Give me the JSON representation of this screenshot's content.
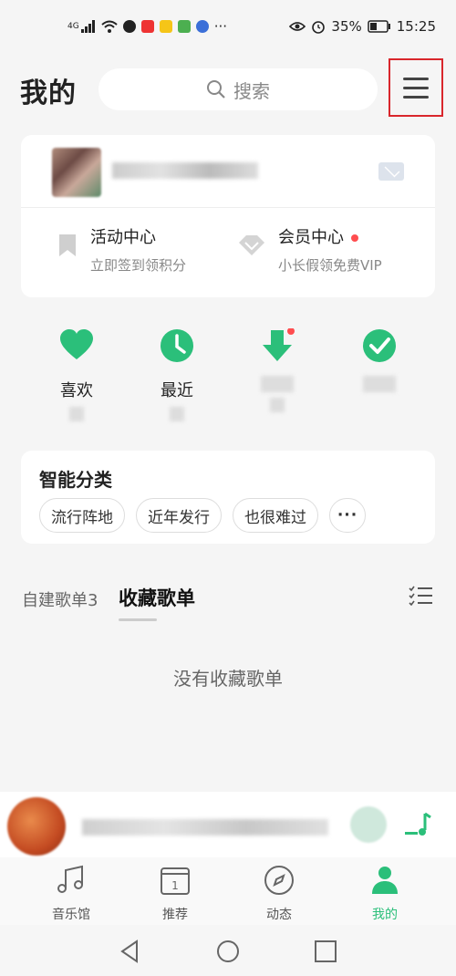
{
  "status_bar": {
    "network": "4G",
    "battery": "35%",
    "time": "15:25",
    "more": "···"
  },
  "header": {
    "title": "我的",
    "search_placeholder": "搜索"
  },
  "profile": {
    "promos": [
      {
        "title": "活动中心",
        "subtitle": "立即签到领积分",
        "icon": "bookmark-icon"
      },
      {
        "title": "会员中心",
        "subtitle": "小长假领免费VIP",
        "icon": "diamond-icon"
      }
    ]
  },
  "quick_actions": [
    {
      "label": "喜欢",
      "icon": "heart-icon"
    },
    {
      "label": "最近",
      "icon": "clock-icon"
    },
    {
      "label": "",
      "icon": "download-icon"
    },
    {
      "label": "",
      "icon": "check-icon"
    }
  ],
  "smart_category": {
    "title": "智能分类",
    "chips": [
      "流行阵地",
      "近年发行",
      "也很难过"
    ],
    "more": "···"
  },
  "playlist_tabs": {
    "created": "自建歌单3",
    "collected": "收藏歌单",
    "empty_text": "没有收藏歌单"
  },
  "bottom_nav": [
    {
      "label": "音乐馆",
      "icon": "music-note-icon",
      "active": false
    },
    {
      "label": "推荐",
      "icon": "calendar-icon",
      "active": false
    },
    {
      "label": "动态",
      "icon": "compass-icon",
      "active": false
    },
    {
      "label": "我的",
      "icon": "person-icon",
      "active": true
    }
  ],
  "colors": {
    "accent": "#2bbf7a",
    "highlight_box": "#d9262c",
    "badge": "#ff4d4f"
  }
}
